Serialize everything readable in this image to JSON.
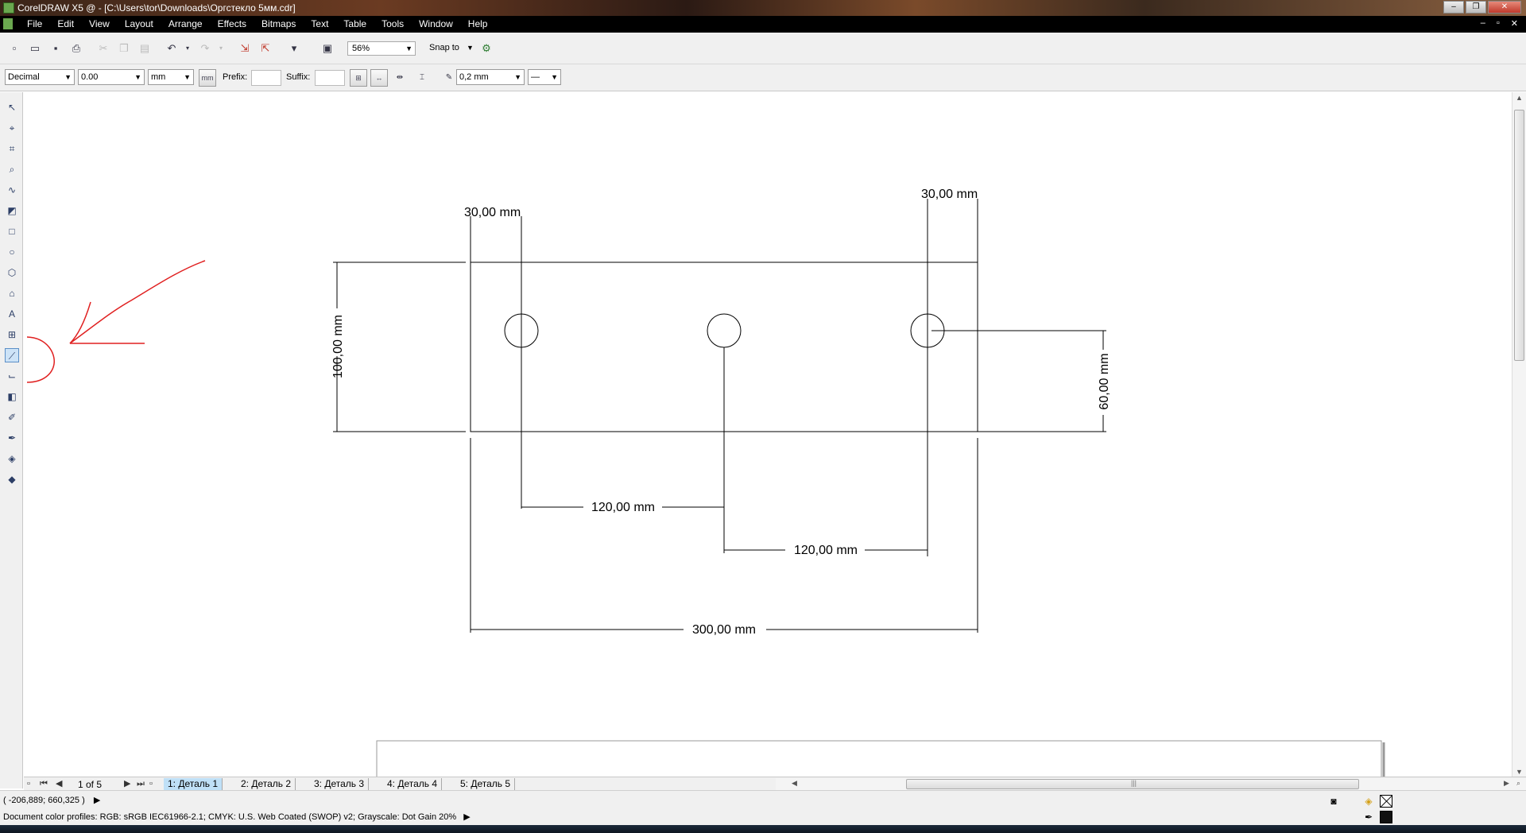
{
  "window": {
    "title": "CorelDRAW X5 @ - [C:\\Users\\tor\\Downloads\\Оргстекло 5мм.cdr]",
    "buttons": [
      "–",
      "❐",
      "✕"
    ]
  },
  "menu": {
    "items": [
      "File",
      "Edit",
      "View",
      "Layout",
      "Arrange",
      "Effects",
      "Bitmaps",
      "Text",
      "Table",
      "Tools",
      "Window",
      "Help"
    ],
    "mdi_buttons": [
      "–",
      "▫",
      "✕"
    ]
  },
  "standard_toolbar": {
    "icons": [
      "new-icon",
      "open-icon",
      "save-icon",
      "print-icon",
      "cut-icon",
      "copy-icon",
      "paste-icon",
      "undo-icon",
      "redo-icon",
      "import-icon",
      "export-icon",
      "application-launcher-icon",
      "welcome-screen-icon"
    ],
    "zoom_level": "56%",
    "snap_label": "Snap to"
  },
  "property_bar": {
    "dimension_style": "Decimal",
    "precision": "0.00",
    "units": "mm",
    "units_button": "mm",
    "prefix_label": "Prefix:",
    "suffix_label": "Suffix:",
    "outline_width": "0,2 mm",
    "line_style": "—"
  },
  "toolbox": {
    "tools": [
      "pick-tool-icon",
      "shape-tool-icon",
      "crop-tool-icon",
      "zoom-tool-icon",
      "freehand-tool-icon",
      "smart-fill-tool-icon",
      "rectangle-tool-icon",
      "ellipse-tool-icon",
      "polygon-tool-icon",
      "basic-shapes-tool-icon",
      "text-tool-icon",
      "table-tool-icon",
      "dimension-tool-icon",
      "connector-tool-icon",
      "blend-tool-icon",
      "eyedropper-tool-icon",
      "outline-tool-icon",
      "fill-tool-icon",
      "interactive-fill-tool-icon"
    ],
    "active_tool": "dimension-tool-icon"
  },
  "drawing": {
    "dimensions": {
      "left_offset": "30,00 mm",
      "right_offset": "30,00 mm",
      "height": "100,00 mm",
      "hole_height": "60,00 mm",
      "hole_spacing_1": "120,00 mm",
      "hole_spacing_2": "120,00 mm",
      "total_width": "300,00 mm"
    },
    "annotation_color": "#e02020"
  },
  "page_navigator": {
    "page_count": "1 of 5",
    "tabs": [
      "1: Деталь 1",
      "2: Деталь 2",
      "3: Деталь 3",
      "4: Деталь 4",
      "5: Деталь 5"
    ],
    "active_tab": 0
  },
  "status": {
    "coordinates": "( -206,889; 660,325 )",
    "color_profiles": "Document color profiles: RGB: sRGB IEC61966-2.1; CMYK: U.S. Web Coated (SWOP) v2; Grayscale: Dot Gain 20%"
  }
}
